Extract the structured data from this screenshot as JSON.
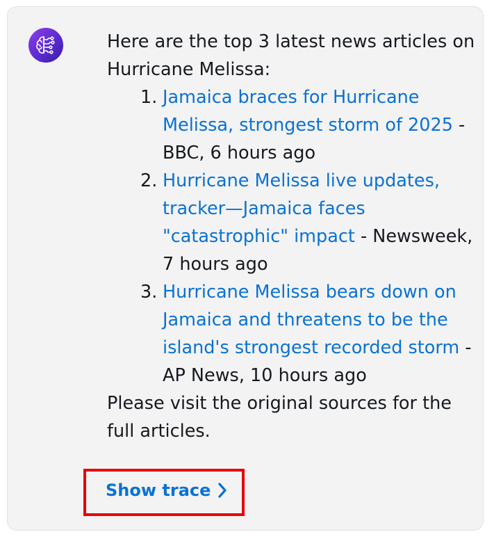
{
  "message": {
    "intro": "Here are the top 3 latest news articles on Hurricane Melissa:",
    "articles": [
      {
        "number": "1.",
        "title": "Jamaica braces for Hurricane Melissa, strongest storm of 2025",
        "source": " - BBC, 6 hours ago"
      },
      {
        "number": "2.",
        "title": "Hurricane Melissa live updates, tracker—Jamaica faces \"catastrophic\" impact",
        "source": " - Newsweek, 7 hours ago"
      },
      {
        "number": "3.",
        "title": "Hurricane Melissa bears down on Jamaica and threatens to be the island's strongest recorded storm",
        "source": " - AP News, 10 hours ago"
      }
    ],
    "outro": "Please visit the original sources for the full articles."
  },
  "trace": {
    "label": "Show trace"
  },
  "avatar": {
    "icon": "ai-brain-circuit-icon"
  },
  "colors": {
    "link": "#0972d3",
    "text": "#16191f",
    "card_bg": "#f3f3f3",
    "highlight_border": "#e8000b",
    "avatar_purple": "#6b2fdc"
  }
}
